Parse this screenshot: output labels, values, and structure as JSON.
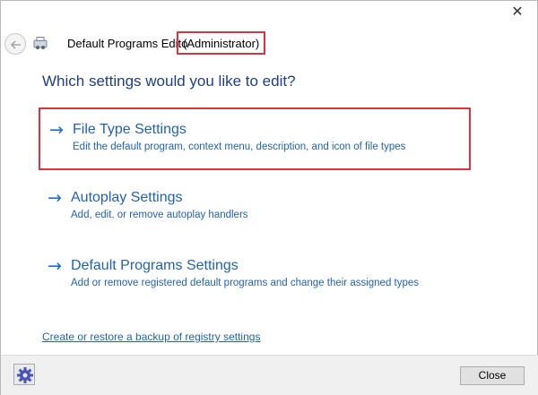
{
  "window": {
    "close_glyph": "✕",
    "title": "Default Programs Edito",
    "title_suffix": "(Administrator)"
  },
  "heading": "Which settings would you like to edit?",
  "options": [
    {
      "title": "File Type Settings",
      "description": "Edit the default program, context menu, description, and icon of file types",
      "highlighted": true
    },
    {
      "title": "Autoplay Settings",
      "description": "Add, edit, or remove autoplay handlers",
      "highlighted": false
    },
    {
      "title": "Default Programs Settings",
      "description": "Add or remove registered default programs and change their assigned types",
      "highlighted": false
    }
  ],
  "arrow_glyph": "→",
  "backup_link": "Create or restore a backup of registry settings",
  "footer": {
    "close_label": "Close"
  },
  "icons": {
    "back": "back-arrow-icon",
    "app": "default-programs-icon",
    "settings": "gear-icon"
  },
  "colors": {
    "link": "#1f62b8",
    "heading": "#1e3d8f",
    "highlight": "#e0323c"
  }
}
